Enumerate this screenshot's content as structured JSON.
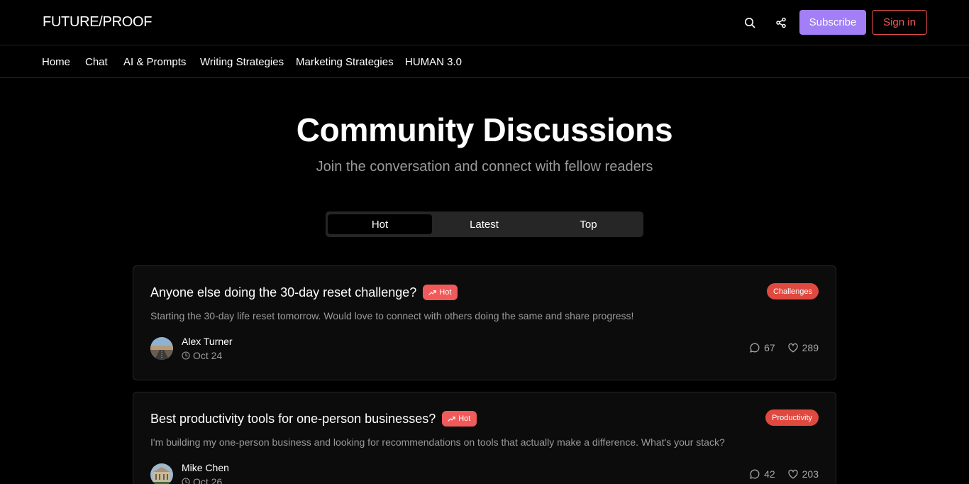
{
  "header": {
    "logo": "FUTURE/PROOF",
    "subscribe_label": "Subscribe",
    "signin_label": "Sign in"
  },
  "nav": {
    "items": [
      "Home",
      "Chat",
      "AI & Prompts",
      "Writing Strategies",
      "Marketing Strategies",
      "HUMAN 3.0"
    ]
  },
  "hero": {
    "title": "Community Discussions",
    "subtitle": "Join the conversation and connect with fellow readers"
  },
  "tabs": {
    "items": [
      "Hot",
      "Latest",
      "Top"
    ],
    "active": "Hot"
  },
  "colors": {
    "accent": "#a27ef7",
    "danger": "#f05a5a",
    "badge": "#e0493f",
    "muted": "#9a9a9a",
    "card_bg": "#0c0c0c"
  },
  "posts": [
    {
      "title": "Anyone else doing the 30-day reset challenge?",
      "hot_label": "Hot",
      "category": "Challenges",
      "excerpt": "Starting the 30-day life reset tomorrow. Would love to connect with others doing the same and share progress!",
      "author": "Alex Turner",
      "date": "Oct 24",
      "comments": "67",
      "likes": "289",
      "avatar_icon": "road-landscape-avatar"
    },
    {
      "title": "Best productivity tools for one-person businesses?",
      "hot_label": "Hot",
      "category": "Productivity",
      "excerpt": "I'm building my one-person business and looking for recommendations on tools that actually make a difference. What's your stack?",
      "author": "Mike Chen",
      "date": "Oct 26",
      "comments": "42",
      "likes": "203",
      "avatar_icon": "building-avatar"
    }
  ]
}
